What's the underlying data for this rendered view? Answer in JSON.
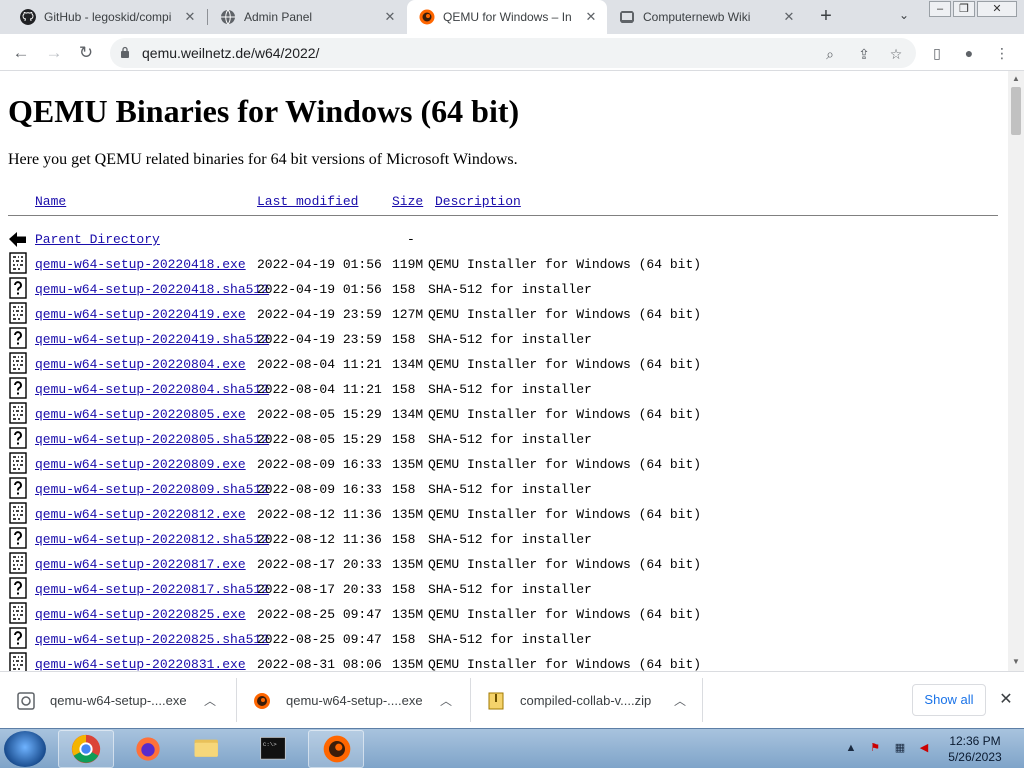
{
  "browser": {
    "tabs": [
      {
        "title": "GitHub - legoskid/compil",
        "icon": "github-icon"
      },
      {
        "title": "Admin Panel",
        "icon": "globe-icon"
      },
      {
        "title": "QEMU for Windows – Ins",
        "icon": "qemu-icon"
      },
      {
        "title": "Computernewb Wiki",
        "icon": "wiki-icon"
      }
    ],
    "new_tab": "+",
    "url": "qemu.weilnetz.de/w64/2022/"
  },
  "page": {
    "title": "QEMU Binaries for Windows (64 bit)",
    "intro": "Here you get QEMU related binaries for 64 bit versions of Microsoft Windows.",
    "columns": {
      "name": "Name",
      "modified": "Last modified",
      "size": "Size",
      "description": "Description"
    },
    "parent": {
      "name": "Parent Directory",
      "size": "-"
    },
    "files": [
      {
        "name": "qemu-w64-setup-20220418.exe",
        "modified": "2022-04-19 01:56",
        "size": "119M",
        "description": "QEMU Installer for Windows (64 bit)",
        "kind": "binary"
      },
      {
        "name": "qemu-w64-setup-20220418.sha512",
        "modified": "2022-04-19 01:56",
        "size": "158",
        "description": "SHA-512 for installer",
        "kind": "unknown"
      },
      {
        "name": "qemu-w64-setup-20220419.exe",
        "modified": "2022-04-19 23:59",
        "size": "127M",
        "description": "QEMU Installer for Windows (64 bit)",
        "kind": "binary"
      },
      {
        "name": "qemu-w64-setup-20220419.sha512",
        "modified": "2022-04-19 23:59",
        "size": "158",
        "description": "SHA-512 for installer",
        "kind": "unknown"
      },
      {
        "name": "qemu-w64-setup-20220804.exe",
        "modified": "2022-08-04 11:21",
        "size": "134M",
        "description": "QEMU Installer for Windows (64 bit)",
        "kind": "binary"
      },
      {
        "name": "qemu-w64-setup-20220804.sha512",
        "modified": "2022-08-04 11:21",
        "size": "158",
        "description": "SHA-512 for installer",
        "kind": "unknown"
      },
      {
        "name": "qemu-w64-setup-20220805.exe",
        "modified": "2022-08-05 15:29",
        "size": "134M",
        "description": "QEMU Installer for Windows (64 bit)",
        "kind": "binary"
      },
      {
        "name": "qemu-w64-setup-20220805.sha512",
        "modified": "2022-08-05 15:29",
        "size": "158",
        "description": "SHA-512 for installer",
        "kind": "unknown"
      },
      {
        "name": "qemu-w64-setup-20220809.exe",
        "modified": "2022-08-09 16:33",
        "size": "135M",
        "description": "QEMU Installer for Windows (64 bit)",
        "kind": "binary"
      },
      {
        "name": "qemu-w64-setup-20220809.sha512",
        "modified": "2022-08-09 16:33",
        "size": "158",
        "description": "SHA-512 for installer",
        "kind": "unknown"
      },
      {
        "name": "qemu-w64-setup-20220812.exe",
        "modified": "2022-08-12 11:36",
        "size": "135M",
        "description": "QEMU Installer for Windows (64 bit)",
        "kind": "binary"
      },
      {
        "name": "qemu-w64-setup-20220812.sha512",
        "modified": "2022-08-12 11:36",
        "size": "158",
        "description": "SHA-512 for installer",
        "kind": "unknown"
      },
      {
        "name": "qemu-w64-setup-20220817.exe",
        "modified": "2022-08-17 20:33",
        "size": "135M",
        "description": "QEMU Installer for Windows (64 bit)",
        "kind": "binary"
      },
      {
        "name": "qemu-w64-setup-20220817.sha512",
        "modified": "2022-08-17 20:33",
        "size": "158",
        "description": "SHA-512 for installer",
        "kind": "unknown"
      },
      {
        "name": "qemu-w64-setup-20220825.exe",
        "modified": "2022-08-25 09:47",
        "size": "135M",
        "description": "QEMU Installer for Windows (64 bit)",
        "kind": "binary"
      },
      {
        "name": "qemu-w64-setup-20220825.sha512",
        "modified": "2022-08-25 09:47",
        "size": "158",
        "description": "SHA-512 for installer",
        "kind": "unknown"
      },
      {
        "name": "qemu-w64-setup-20220831.exe",
        "modified": "2022-08-31 08:06",
        "size": "135M",
        "description": "QEMU Installer for Windows (64 bit)",
        "kind": "binary"
      }
    ]
  },
  "downloads": {
    "items": [
      {
        "name": "qemu-w64-setup-....exe",
        "icon": "installer-icon"
      },
      {
        "name": "qemu-w64-setup-....exe",
        "icon": "qemu-icon"
      },
      {
        "name": "compiled-collab-v....zip",
        "icon": "zip-icon"
      }
    ],
    "show_all": "Show all"
  },
  "taskbar": {
    "time": "12:36 PM",
    "date": "5/26/2023"
  },
  "colors": {
    "link": "#1a0dab",
    "accent": "#1a73e8"
  }
}
